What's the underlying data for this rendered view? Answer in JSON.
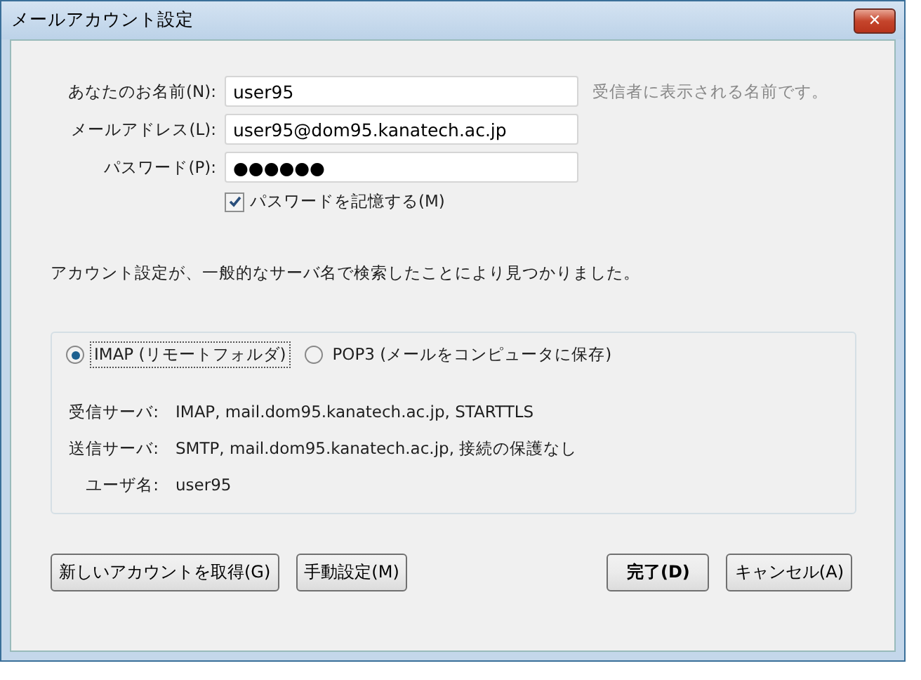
{
  "window": {
    "title": "メールアカウント設定",
    "close_label": "✕"
  },
  "fields": [
    {
      "label": "あなたのお名前(N):",
      "value": "user95",
      "hint": "受信者に表示される名前です。"
    },
    {
      "label": "メールアドレス(L):",
      "value": "user95@dom95.kanatech.ac.jp"
    },
    {
      "label": "パスワード(P):",
      "value": "●●●●●●"
    }
  ],
  "remember": {
    "label": "パスワードを記憶する(M)",
    "checked": true
  },
  "message": "アカウント設定が、一般的なサーバ名で検索したことにより見つかりました。",
  "protocols": [
    {
      "label": "IMAP (リモートフォルダ)",
      "selected": true
    },
    {
      "label": "POP3 (メールをコンピュータに保存)",
      "selected": false
    }
  ],
  "details": [
    {
      "label": "受信サーバ:",
      "value": "IMAP, mail.dom95.kanatech.ac.jp, STARTTLS"
    },
    {
      "label": "送信サーバ:",
      "value": "SMTP, mail.dom95.kanatech.ac.jp, 接続の保護なし"
    },
    {
      "label": "ユーザ名:",
      "value": "user95"
    }
  ],
  "left_buttons": [
    {
      "label": "新しいアカウントを取得(G)",
      "default": false
    },
    {
      "label": "手動設定(M)",
      "default": false
    }
  ],
  "right_buttons": [
    {
      "label": "完了(D)",
      "default": true
    },
    {
      "label": "キャンセル(A)",
      "default": false
    }
  ]
}
